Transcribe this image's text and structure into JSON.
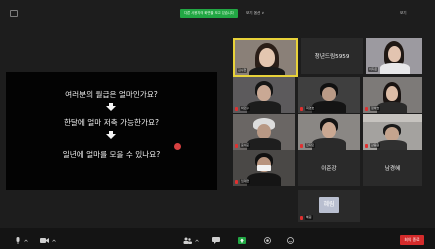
{
  "top_bar": {
    "recording_banner": "다른 사용자의 화면을 보고 있습니다",
    "view_options_label": "보기 옵션 ∨",
    "view_button": "보기"
  },
  "shared_screen": {
    "questions": [
      "여러분의 월급은 얼마인가요?",
      "한달에 얼마 저축 가능한가요?",
      "일년에 얼마를 모을 수 있나요?"
    ]
  },
  "participants": {
    "tile_1_name": "김수현",
    "tile_2_center": "청년드림5959",
    "tile_3_name": "이지은",
    "tile_4_name": "박민수",
    "tile_5_name": "최영호",
    "tile_6_name": "정하늘",
    "tile_7_name": "윤서준",
    "tile_8_name": "한지민",
    "tile_9_name": "강동원",
    "tile_10_name": "임재현",
    "tile_11_center": "이준강",
    "tile_12_center": "남경혜",
    "tile_13_label": "혜림",
    "tile_13_name": "혜림"
  },
  "toolbar": {
    "end_button": "회의 종료"
  },
  "colors": {
    "active_speaker_border": "#e8d23a",
    "banner_green": "#22a744",
    "end_red": "#d42b2b",
    "muted_red": "#e03030"
  }
}
